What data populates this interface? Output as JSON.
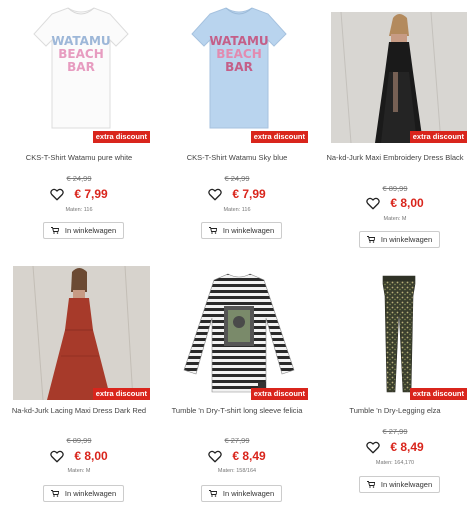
{
  "colors": {
    "accent": "#d9251c",
    "badge_bg": "#d9251c"
  },
  "products": [
    {
      "name": "CKS-T-Shirt Watamu pure white",
      "badge": "extra discount",
      "old_price": "€ 24,99",
      "price": "€ 7,99",
      "sizes": "Maten: 116",
      "cart_label": "In winkelwagen",
      "image_text": "WATAMU BEACH BAR"
    },
    {
      "name": "CKS-T-Shirt Watamu Sky blue",
      "badge": "extra discount",
      "old_price": "€ 24,99",
      "price": "€ 7,99",
      "sizes": "Maten: 116",
      "cart_label": "In winkelwagen",
      "image_text": "WATAMU BEACH BAR"
    },
    {
      "name": "Na-kd-Jurk Maxi Embroidery Dress Black",
      "badge": "extra discount",
      "old_price": "€ 89,99",
      "price": "€ 8,00",
      "sizes": "Maten: M",
      "cart_label": "In winkelwagen"
    },
    {
      "name": "Na-kd-Jurk Lacing Maxi Dress Dark Red",
      "badge": "extra discount",
      "old_price": "€ 89,99",
      "price": "€ 8,00",
      "sizes": "Maten: M",
      "cart_label": "In winkelwagen"
    },
    {
      "name": "Tumble 'n Dry-T-shirt long sleeve felicia",
      "badge": "extra discount",
      "old_price": "€ 27,99",
      "price": "€ 8,49",
      "sizes": "Maten: 158/164",
      "cart_label": "In winkelwagen"
    },
    {
      "name": "Tumble 'n Dry-Legging elza",
      "badge": "extra discount",
      "old_price": "€ 27,99",
      "price": "€ 8,49",
      "sizes": "Maten: 164,170",
      "cart_label": "In winkelwagen"
    }
  ]
}
